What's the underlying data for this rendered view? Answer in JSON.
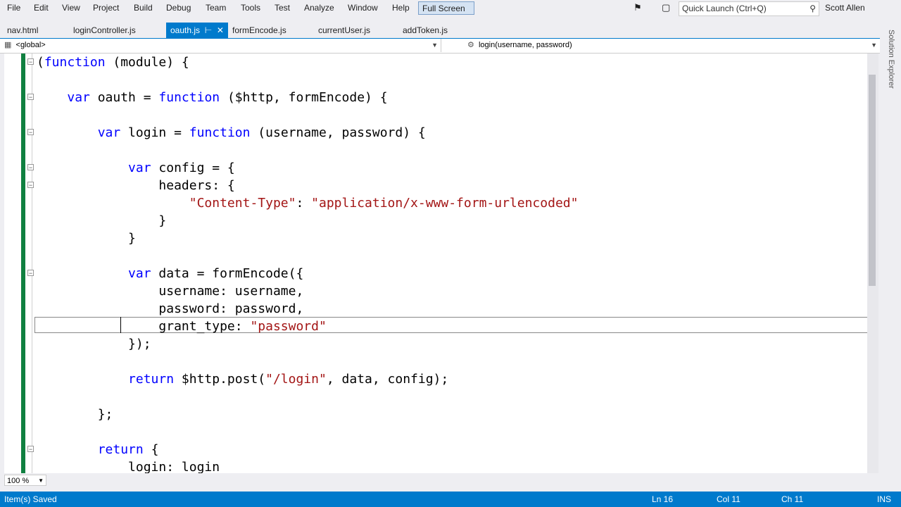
{
  "menu": [
    "File",
    "Edit",
    "View",
    "Project",
    "Build",
    "Debug",
    "Team",
    "Tools",
    "Test",
    "Analyze",
    "Window",
    "Help"
  ],
  "full_screen_label": "Full Screen",
  "quick_launch_placeholder": "Quick Launch (Ctrl+Q)",
  "user_name": "Scott Allen",
  "tabs": [
    "nav.html",
    "loginController.js",
    "oauth.js",
    "formEncode.js",
    "currentUser.js",
    "addToken.js"
  ],
  "active_tab": "oauth.js",
  "nav_scope": "<global>",
  "nav_member": "login(username, password)",
  "side_panel_label": "Solution Explorer",
  "code": [
    "(function (module) {",
    "",
    "    var oauth = function ($http, formEncode) {",
    "",
    "        var login = function (username, password) {",
    "",
    "            var config = {",
    "                headers: {",
    "                    \"Content-Type\": \"application/x-www-form-urlencoded\"",
    "                }",
    "            }",
    "",
    "            var data = formEncode({",
    "                username: username,",
    "                password: password,",
    "                grant_type: \"password\"",
    "            });",
    "",
    "            return $http.post(\"/login\", data, config);",
    "",
    "        };",
    "",
    "        return {",
    "            login: login"
  ],
  "zoom": "100 %",
  "status": {
    "message": "Item(s) Saved",
    "ln": "Ln 16",
    "col": "Col 11",
    "ch": "Ch 11",
    "mode": "INS"
  }
}
